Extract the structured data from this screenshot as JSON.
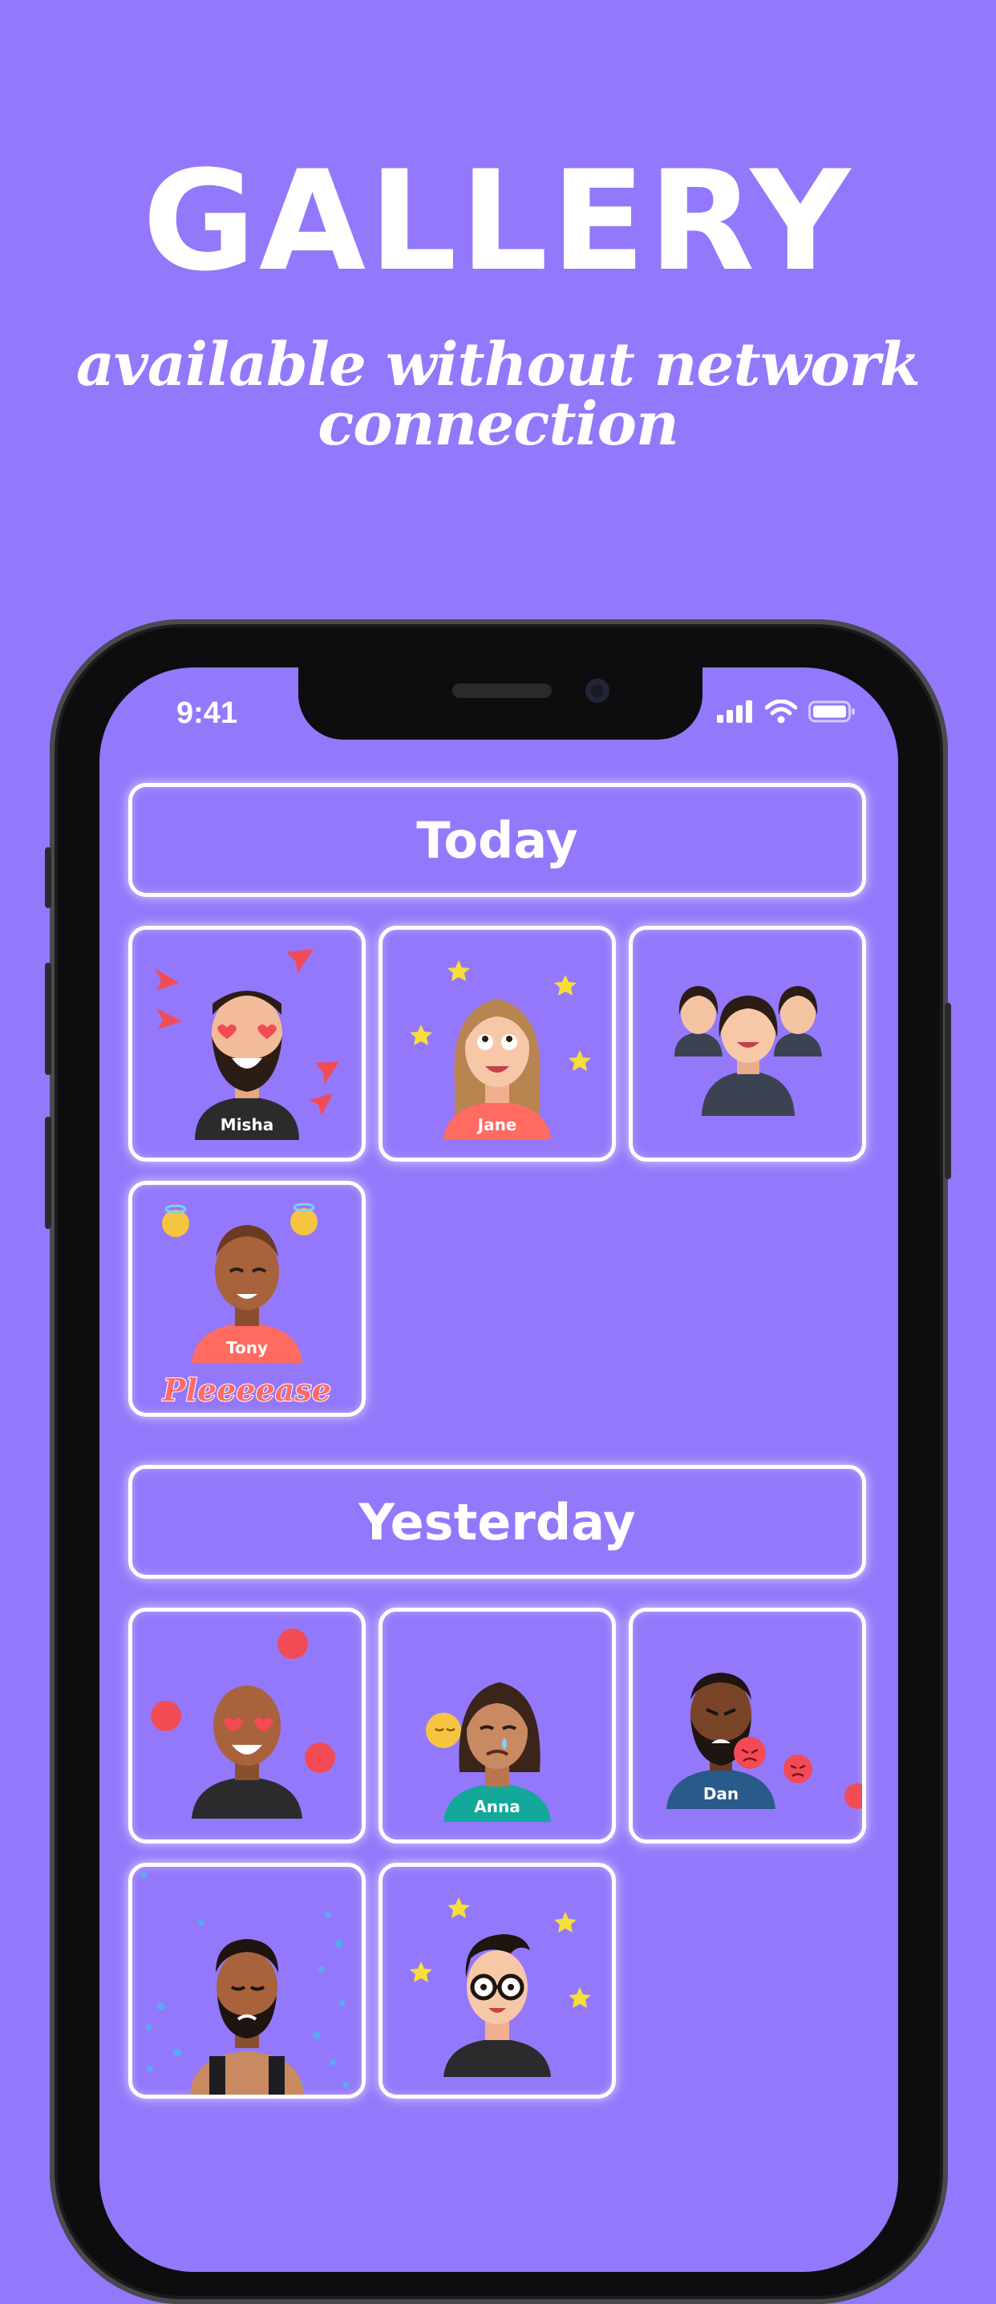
{
  "headline": "GALLERY",
  "subline": "available without network connection",
  "status_bar": {
    "time": "9:41"
  },
  "sections": [
    {
      "title": "Today"
    },
    {
      "title": "Yesterday"
    }
  ],
  "tiles": {
    "misha": {
      "name": "Misha"
    },
    "jane": {
      "name": "Jane"
    },
    "tony": {
      "name": "Tony",
      "caption": "Pleeeease"
    },
    "anna": {
      "name": "Anna"
    },
    "dan": {
      "name": "Dan"
    }
  },
  "colors": {
    "background": "#9478fb",
    "tile_border": "#ffffff",
    "phone_frame": "#0d0d0f"
  }
}
